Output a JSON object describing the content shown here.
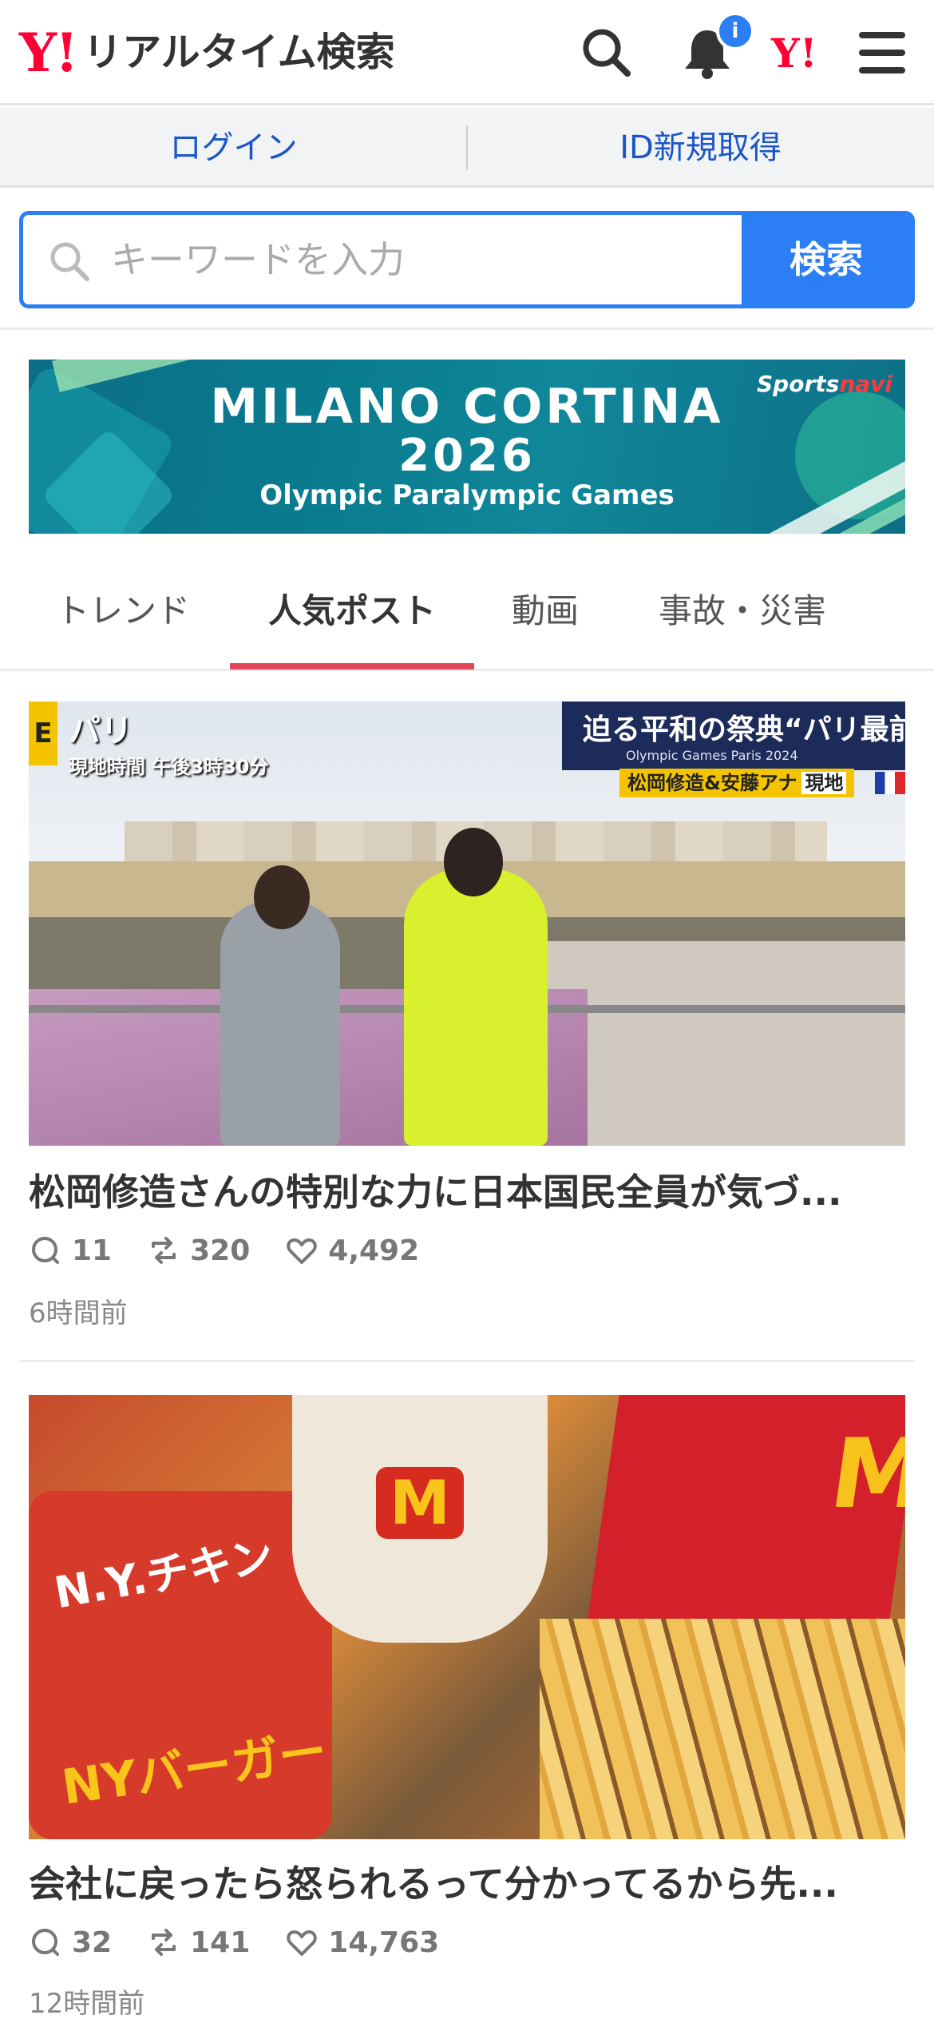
{
  "header": {
    "logo_mark": "Y!",
    "logo_text": "リアルタイム検索",
    "notification_badge": "i",
    "yahoo_mark": "Y!"
  },
  "auth": {
    "login": "ログイン",
    "signup": "ID新規取得"
  },
  "search": {
    "placeholder": "キーワードを入力",
    "button": "検索"
  },
  "banner": {
    "title_line1": "MILANO CORTINA",
    "title_line2": "2026",
    "title_line3": "Olympic Paralympic Games",
    "brand_sports": "Sports",
    "brand_navi": "navi"
  },
  "tabs": [
    {
      "label": "トレンド",
      "active": false
    },
    {
      "label": "人気ポスト",
      "active": true
    },
    {
      "label": "動画",
      "active": false
    },
    {
      "label": "事故・災害",
      "active": false
    }
  ],
  "posts": [
    {
      "title": "松岡修造さんの特別な力に日本国民全員が気づ...",
      "replies": "11",
      "reposts": "320",
      "likes": "4,492",
      "time": "6時間前",
      "image_text": {
        "corner_tag": "E",
        "location": "パリ",
        "local_time": "現地時間 午後3時30分",
        "headline": "迫る平和の祭典“パリ最前",
        "subheadline": "Olympic Games Paris 2024",
        "names": "松岡修造&安藤アナ",
        "onsite": "現地"
      }
    },
    {
      "title": "会社に戻ったら怒られるって分かってるから先...",
      "replies": "32",
      "reposts": "141",
      "likes": "14,763",
      "time": "12時間前",
      "image_text": {
        "wrapper_line1": "N.Y.チキン",
        "wrapper_line2": "NYバーガー",
        "cup_logo": "M",
        "box_logo": "M"
      }
    }
  ],
  "colors": {
    "brand_red": "#ff0033",
    "accent_blue": "#2c7ef5",
    "link_blue": "#1a56c8",
    "tab_underline": "#e0475b"
  }
}
